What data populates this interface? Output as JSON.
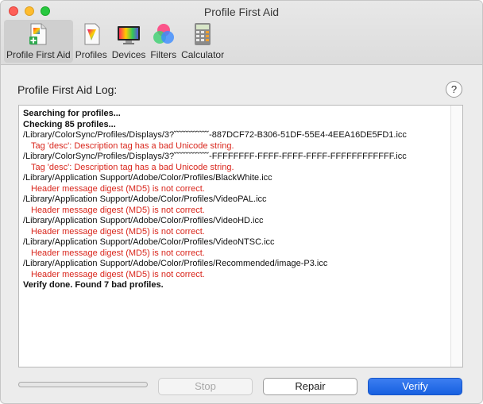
{
  "window": {
    "title": "Profile First Aid"
  },
  "toolbar": {
    "items": [
      {
        "label": "Profile First Aid",
        "icon": "first-aid-document-icon",
        "selected": true
      },
      {
        "label": "Profiles",
        "icon": "color-profile-icon",
        "selected": false
      },
      {
        "label": "Devices",
        "icon": "display-monitor-icon",
        "selected": false
      },
      {
        "label": "Filters",
        "icon": "rgb-circles-icon",
        "selected": false
      },
      {
        "label": "Calculator",
        "icon": "calculator-icon",
        "selected": false
      }
    ]
  },
  "log": {
    "label": "Profile First Aid Log:",
    "help": "?",
    "lines": [
      {
        "text": "Searching for profiles...",
        "kind": "bold"
      },
      {
        "text": "Checking 85 profiles...",
        "kind": "bold"
      },
      {
        "text": "/Library/ColorSync/Profiles/Displays/3?˘˘˘˘˘˘˘˘˘˘˘˘-887DCF72-B306-51DF-55E4-4EEA16DE5FD1.icc",
        "kind": "normal"
      },
      {
        "text": "Tag 'desc': Description tag has a bad Unicode string.",
        "kind": "err"
      },
      {
        "text": "/Library/ColorSync/Profiles/Displays/3?˘˘˘˘˘˘˘˘˘˘˘˘-FFFFFFFF-FFFF-FFFF-FFFF-FFFFFFFFFFFF.icc",
        "kind": "normal"
      },
      {
        "text": "Tag 'desc': Description tag has a bad Unicode string.",
        "kind": "err"
      },
      {
        "text": "/Library/Application Support/Adobe/Color/Profiles/BlackWhite.icc",
        "kind": "normal"
      },
      {
        "text": "Header message digest (MD5) is not correct.",
        "kind": "err"
      },
      {
        "text": "/Library/Application Support/Adobe/Color/Profiles/VideoPAL.icc",
        "kind": "normal"
      },
      {
        "text": "Header message digest (MD5) is not correct.",
        "kind": "err"
      },
      {
        "text": "/Library/Application Support/Adobe/Color/Profiles/VideoHD.icc",
        "kind": "normal"
      },
      {
        "text": "Header message digest (MD5) is not correct.",
        "kind": "err"
      },
      {
        "text": "/Library/Application Support/Adobe/Color/Profiles/VideoNTSC.icc",
        "kind": "normal"
      },
      {
        "text": "Header message digest (MD5) is not correct.",
        "kind": "err"
      },
      {
        "text": "/Library/Application Support/Adobe/Color/Profiles/Recommended/image-P3.icc",
        "kind": "normal"
      },
      {
        "text": "Header message digest (MD5) is not correct.",
        "kind": "err"
      },
      {
        "text": "Verify done. Found 7 bad profiles.",
        "kind": "bold"
      }
    ]
  },
  "actions": {
    "stop": "Stop",
    "repair": "Repair",
    "verify": "Verify",
    "progress": 0
  },
  "colors": {
    "error_text": "#d9261c",
    "accent": "#1760e0"
  }
}
